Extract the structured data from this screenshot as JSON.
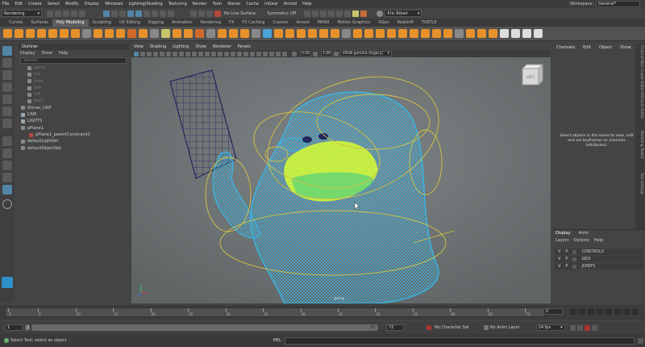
{
  "menubar": [
    "File",
    "Edit",
    "Create",
    "Select",
    "Modify",
    "Display",
    "Windows",
    "Lighting/Shading",
    "Texturing",
    "Render",
    "Toon",
    "Stereo",
    "Cache",
    "mGear",
    "Arnold",
    "Help"
  ],
  "workspace": {
    "label": "Workspace:",
    "value": "General*"
  },
  "statusline": {
    "mode": "Rendering",
    "live_surface": "No Live Surface",
    "symmetry": "Symmetry: Off",
    "user": "Eric Ribeir"
  },
  "shelf_tabs": [
    "Curves",
    "Surfaces",
    "Poly Modeling",
    "Sculpting",
    "UV Editing",
    "Rigging",
    "Animation",
    "Rendering",
    "FX",
    "FX Caching",
    "Custom",
    "Arnold",
    "MASH",
    "Motion Graphics",
    "XGen",
    "Redshift",
    "TURTLE"
  ],
  "shelf_active": "Poly Modeling",
  "outliner": {
    "title": "Outliner",
    "menu": [
      "Display",
      "Show",
      "Help"
    ],
    "search_placeholder": "Search...",
    "items": [
      {
        "label": "persp",
        "dim": true
      },
      {
        "label": "top",
        "dim": true
      },
      {
        "label": "front",
        "dim": true
      },
      {
        "label": "side",
        "dim": true
      },
      {
        "label": "left",
        "dim": true
      },
      {
        "label": "back",
        "dim": true
      },
      {
        "label": "Slimes_GRP",
        "dim": false
      },
      {
        "label": "CAM",
        "dim": false
      },
      {
        "label": "LIGHTS",
        "dim": false
      },
      {
        "label": "pPlane1",
        "dim": false
      },
      {
        "label": "pPlane1_parentConstraint1",
        "dim": false
      },
      {
        "label": "defaultLightSet",
        "dim": false
      },
      {
        "label": "defaultObjectSet",
        "dim": false
      }
    ]
  },
  "viewport": {
    "menu": [
      "View",
      "Shading",
      "Lighting",
      "Show",
      "Renderer",
      "Panels"
    ],
    "exposure": "0.00",
    "gamma": "1.00",
    "color_space": "sRGB gamma (legacy)",
    "camera": "persp",
    "cube_label": "LEFT"
  },
  "channelbox": {
    "menu": [
      "Channels",
      "Edit",
      "Object",
      "Show"
    ],
    "message": "Select objects in the scene to view, edit and set keyframes on channels (attributes)."
  },
  "side_tabs": [
    "Channel Box / Layer Editor",
    "Attribute Editor",
    "Modeling Toolkit",
    "Tool Settings"
  ],
  "layers": {
    "tabs": [
      "Display",
      "Anim"
    ],
    "menu": [
      "Layers",
      "Options",
      "Help"
    ],
    "rows": [
      {
        "v": "V",
        "p": "P",
        "name": "CONTROLS"
      },
      {
        "v": "V",
        "p": "P",
        "name": "GEO"
      },
      {
        "v": "V",
        "p": "P",
        "name": "JOINTS"
      }
    ]
  },
  "timeline": {
    "ticks": [
      "1",
      "5",
      "10",
      "15",
      "20",
      "25",
      "30",
      "35",
      "40",
      "45",
      "50",
      "55",
      "60",
      "65",
      "70"
    ],
    "current": "0"
  },
  "range": {
    "start": "1",
    "start2": "1",
    "end": "72",
    "end2": "72",
    "char_set": "No Character Set",
    "anim_layer": "No Anim Layer",
    "fps": "24 fps"
  },
  "command": {
    "help": "Select Tool: select an object",
    "mel": "MEL"
  }
}
